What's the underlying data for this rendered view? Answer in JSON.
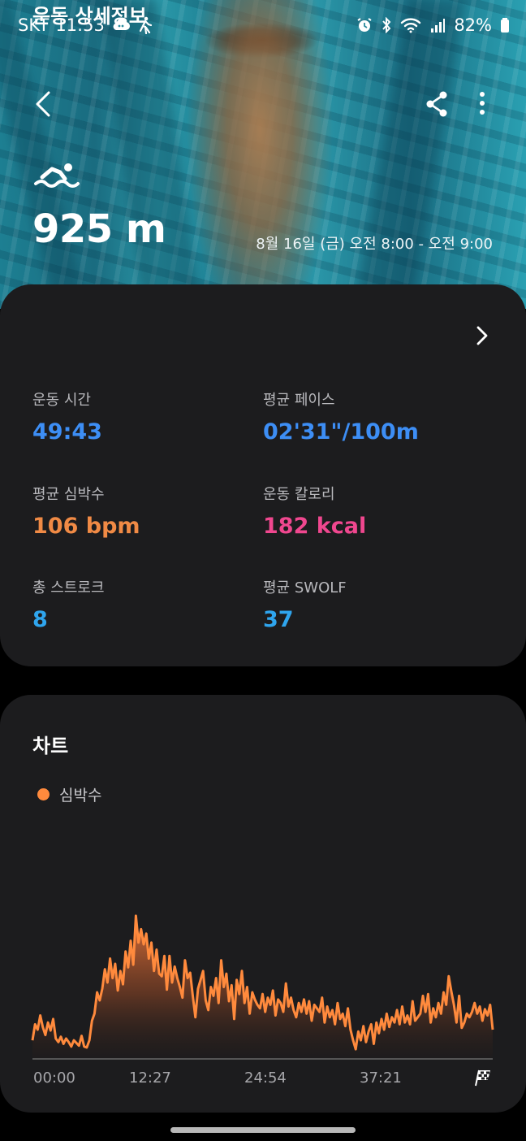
{
  "status_bar": {
    "carrier": "SKT",
    "time": "11:53",
    "icons_left": [
      "cloud-chat-icon",
      "walking-icon"
    ],
    "icons_right": [
      "alarm-icon",
      "bluetooth-icon",
      "wifi-icon",
      "signal-icon",
      "battery-icon"
    ],
    "battery": "82%"
  },
  "header": {
    "distance": "925 m",
    "date_range": "8월 16일 (금) 오전 8:00 - 오전 9:00",
    "activity_icon": "swimming-icon"
  },
  "details": {
    "title": "운동 상세정보",
    "metrics": [
      {
        "label": "운동 시간",
        "value": "49:43",
        "color": "#3d8ef5"
      },
      {
        "label": "평균 페이스",
        "value": "02'31\"/100m",
        "color": "#3d8ef5"
      },
      {
        "label": "평균 심박수",
        "value": "106 bpm",
        "color": "#f08a45"
      },
      {
        "label": "운동 칼로리",
        "value": "182 kcal",
        "color": "#f0478f"
      },
      {
        "label": "총 스트로크",
        "value": "8",
        "color": "#2fa5ee"
      },
      {
        "label": "평균 SWOLF",
        "value": "37",
        "color": "#2fa5ee"
      }
    ]
  },
  "chart_section": {
    "title": "차트",
    "legend": "심박수",
    "accent": "#ff8a3d"
  },
  "chart_data": {
    "type": "area",
    "series": [
      {
        "name": "심박수",
        "values": [
          40,
          58,
          52,
          68,
          55,
          46,
          60,
          51,
          64,
          42,
          38,
          44,
          36,
          42,
          38,
          33,
          40,
          37,
          34,
          45,
          33,
          32,
          40,
          62,
          70,
          94,
          85,
          98,
          120,
          105,
          132,
          110,
          126,
          96,
          118,
          103,
          140,
          122,
          152,
          125,
          180,
          150,
          165,
          148,
          160,
          132,
          150,
          118,
          142,
          115,
          112,
          135,
          97,
          135,
          105,
          123,
          110,
          100,
          88,
          130,
          110,
          116,
          90,
          66,
          98,
          108,
          118,
          85,
          74,
          100,
          90,
          110,
          82,
          130,
          100,
          115,
          84,
          102,
          64,
          108,
          92,
          118,
          82,
          100,
          70,
          94,
          86,
          80,
          76,
          92,
          72,
          88,
          80,
          96,
          68,
          86,
          82,
          72,
          104,
          78,
          88,
          74,
          66,
          82,
          72,
          86,
          70,
          84,
          62,
          80,
          76,
          72,
          88,
          60,
          78,
          66,
          74,
          58,
          82,
          64,
          70,
          56,
          76,
          52,
          40,
          30,
          50,
          40,
          56,
          38,
          50,
          58,
          36,
          60,
          48,
          64,
          52,
          70,
          55,
          66,
          60,
          74,
          58,
          78,
          60,
          68,
          58,
          84,
          62,
          66,
          70,
          90,
          72,
          92,
          60,
          76,
          66,
          82,
          70,
          94,
          80,
          112,
          95,
          80,
          60,
          90,
          54,
          60,
          70,
          66,
          72,
          82,
          70,
          78,
          62,
          75,
          68,
          80,
          52
        ]
      }
    ],
    "x_ticks": [
      "00:00",
      "12:27",
      "24:54",
      "37:21"
    ],
    "y_range": [
      20,
      190
    ],
    "grid": false,
    "legend_position": "top-left"
  }
}
